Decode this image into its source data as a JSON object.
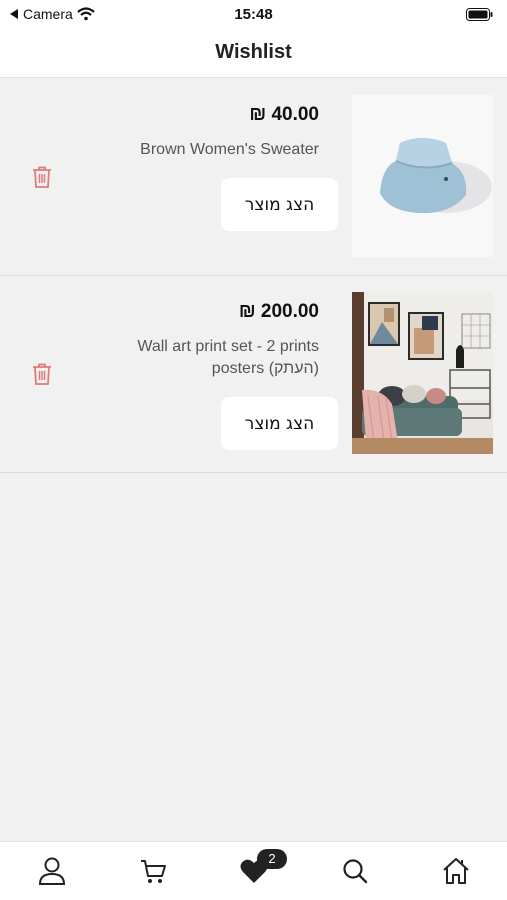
{
  "status_bar": {
    "back_label": "Camera",
    "time": "15:48"
  },
  "header": {
    "title": "Wishlist"
  },
  "items": [
    {
      "price": "₪ 40.00",
      "name": "Brown Women's Sweater",
      "button_label": "הצג מוצר",
      "image_icon": "bucket-hat-image"
    },
    {
      "price": "₪ 200.00",
      "name": "Wall art print set - 2  prints posters (העתק)",
      "button_label": "הצג מוצר",
      "image_icon": "wall-art-room-image"
    }
  ],
  "tabbar": {
    "tabs": [
      "profile-icon",
      "cart-icon",
      "heart-icon",
      "search-icon",
      "home-icon"
    ],
    "wishlist_count": "2"
  },
  "colors": {
    "trash": "#e07b7b",
    "background": "#f1f1f1",
    "badge": "#222222"
  }
}
